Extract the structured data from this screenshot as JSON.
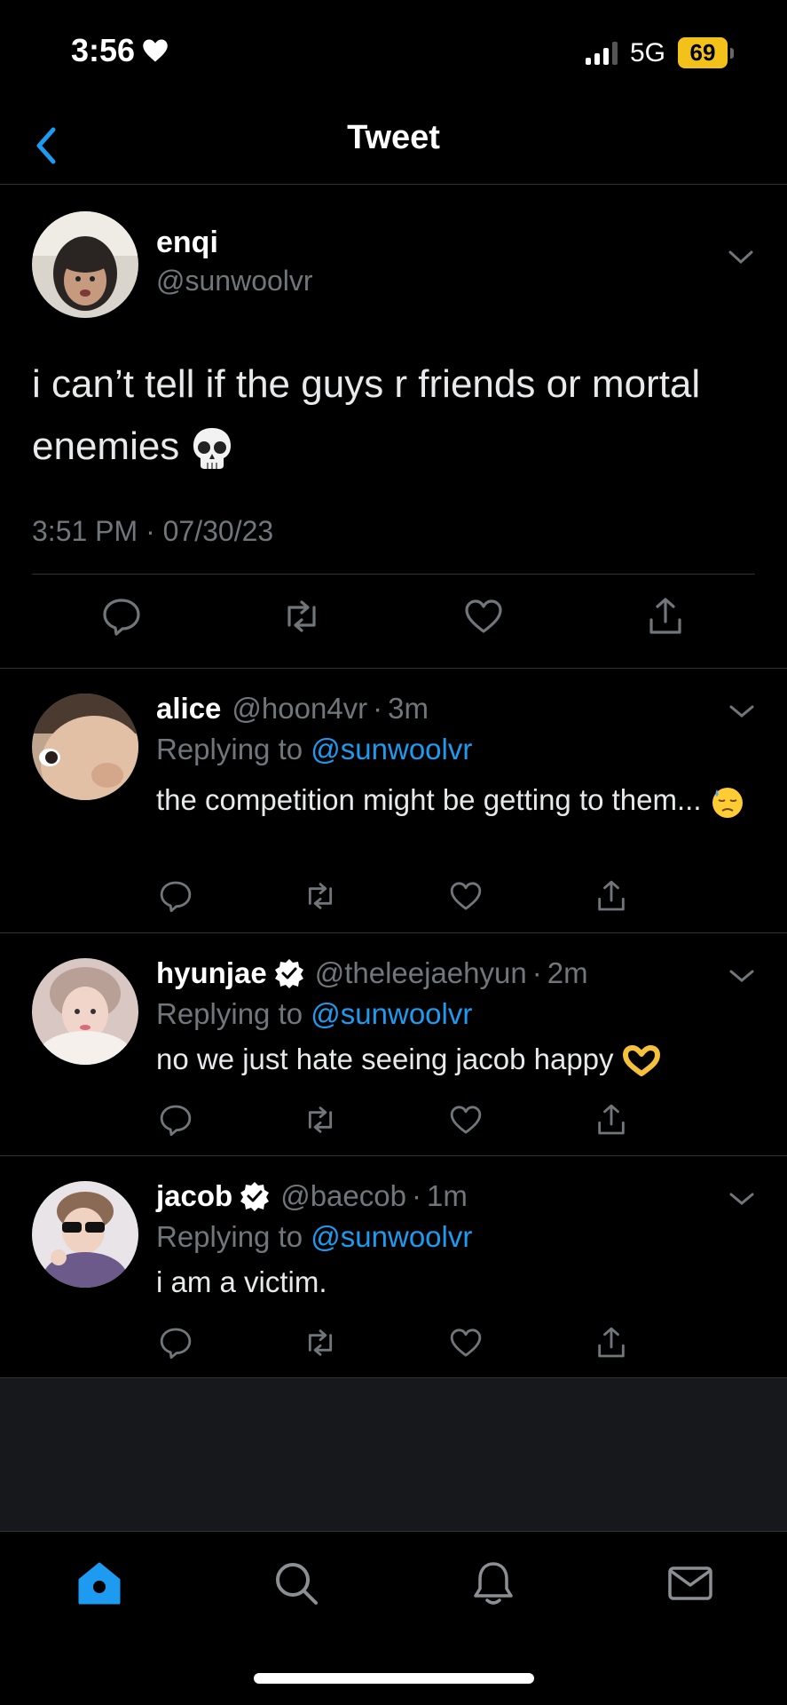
{
  "status_bar": {
    "time": "3:56",
    "network": "5G",
    "battery": "69"
  },
  "nav": {
    "title": "Tweet"
  },
  "main_tweet": {
    "name": "enqi",
    "handle": "@sunwoolvr",
    "text": "i can’t tell if the guys r friends or mortal enemies",
    "emoji": "skull",
    "timestamp": "3:51 PM · 07/30/23"
  },
  "replies": [
    {
      "name": "alice",
      "handle": "@hoon4vr",
      "time": "3m",
      "verified": false,
      "replying_prefix": "Replying to",
      "replying_to": "@sunwoolvr",
      "text": "the competition might be getting to them...",
      "emoji": "downcast-sweat"
    },
    {
      "name": "hyunjae",
      "handle": "@theleejaehyun",
      "time": "2m",
      "verified": true,
      "replying_prefix": "Replying to",
      "replying_to": "@sunwoolvr",
      "text": "no we just hate seeing jacob happy",
      "emoji": "heart-hands"
    },
    {
      "name": "jacob",
      "handle": "@baecob",
      "time": "1m",
      "verified": true,
      "replying_prefix": "Replying to",
      "replying_to": "@sunwoolvr",
      "text": "i am a victim.",
      "emoji": ""
    }
  ],
  "dot_separator": "·",
  "tabs": [
    {
      "name": "home",
      "active": true
    },
    {
      "name": "search",
      "active": false
    },
    {
      "name": "notifications",
      "active": false
    },
    {
      "name": "messages",
      "active": false
    }
  ],
  "colors": {
    "accent": "#1d9bf0",
    "muted": "#71767b",
    "background": "#000000",
    "battery": "#f2c21b"
  }
}
